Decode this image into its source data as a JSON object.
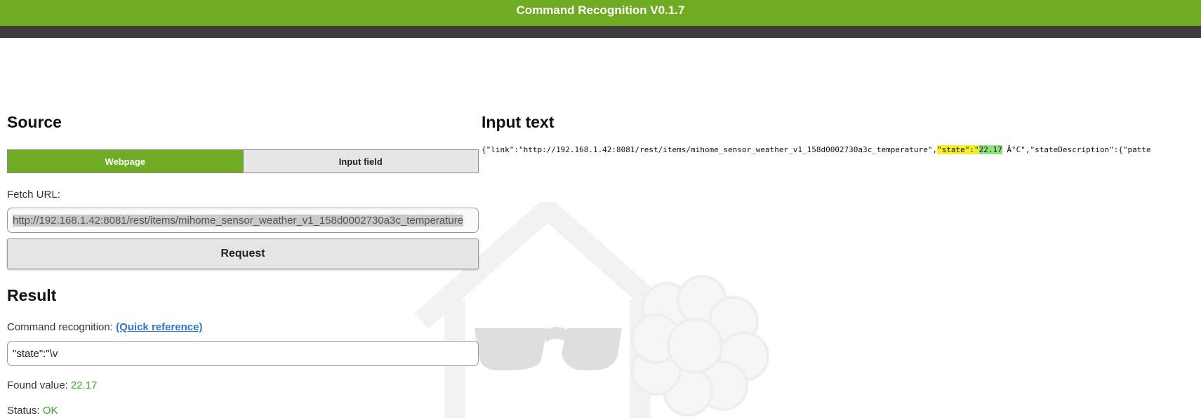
{
  "app": {
    "title": "Command Recognition V0.1.7"
  },
  "colors": {
    "header": "#6fab23",
    "subheader": "#3d3d3d",
    "accent_green": "#3ba02c",
    "link_blue": "#2a78c5",
    "highlight_match": "#f5ef2a",
    "highlight_value": "#8ee37f"
  },
  "source": {
    "title": "Source",
    "tabs": [
      {
        "label": "Webpage",
        "active": true
      },
      {
        "label": "Input field",
        "active": false
      }
    ],
    "fetch_label": "Fetch URL:",
    "fetch_url": "http://192.168.1.42:8081/rest/items/mihome_sensor_weather_v1_158d0002730a3c_temperature",
    "request_button": "Request"
  },
  "result": {
    "title": "Result",
    "command_label": "Command recognition:",
    "quick_reference": "(Quick reference)",
    "command_value": "\"state\":\"\\v",
    "found_label": "Found value:",
    "found_value": "22.17",
    "status_label": "Status:",
    "status_value": "OK"
  },
  "input_text": {
    "title": "Input text",
    "prefix": "{\"link\":\"http://192.168.1.42:8081/rest/items/mihome_sensor_weather_v1_158d0002730a3c_temperature\",",
    "match": "\"state\":\"",
    "value": "22.17",
    "suffix": " Â°C\",\"stateDescription\":{\"patte"
  },
  "watermark": {
    "icon": "openhab-house-sunglasses-raspberry-icon"
  }
}
